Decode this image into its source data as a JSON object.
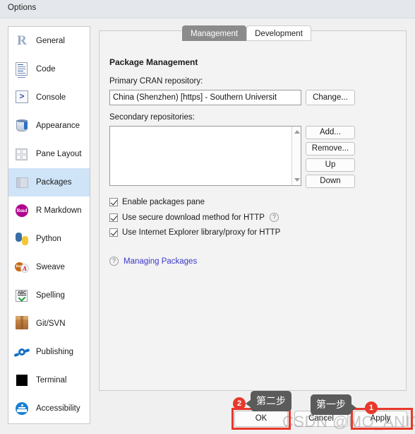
{
  "window": {
    "title": "Options"
  },
  "sidebar": {
    "items": [
      {
        "label": "General",
        "icon": "r-logo-icon"
      },
      {
        "label": "Code",
        "icon": "code-document-icon"
      },
      {
        "label": "Console",
        "icon": "console-prompt-icon"
      },
      {
        "label": "Appearance",
        "icon": "paint-bucket-icon"
      },
      {
        "label": "Pane Layout",
        "icon": "pane-grid-icon"
      },
      {
        "label": "Packages",
        "icon": "package-box-icon",
        "selected": true
      },
      {
        "label": "R Markdown",
        "icon": "rmd-badge-icon"
      },
      {
        "label": "Python",
        "icon": "python-logo-icon"
      },
      {
        "label": "Sweave",
        "icon": "sweave-pdf-icon"
      },
      {
        "label": "Spelling",
        "icon": "spellcheck-abc-icon"
      },
      {
        "label": "Git/SVN",
        "icon": "git-box-icon"
      },
      {
        "label": "Publishing",
        "icon": "publishing-orbit-icon"
      },
      {
        "label": "Terminal",
        "icon": "terminal-square-icon"
      },
      {
        "label": "Accessibility",
        "icon": "accessibility-person-icon"
      }
    ]
  },
  "main": {
    "tabs": [
      {
        "label": "Management",
        "active": true
      },
      {
        "label": "Development",
        "active": false
      }
    ],
    "section_title": "Package Management",
    "cran": {
      "label": "Primary CRAN repository:",
      "value": "China (Shenzhen) [https] - Southern Universit",
      "change_button": "Change..."
    },
    "secondary": {
      "label": "Secondary repositories:",
      "value": "",
      "buttons": [
        "Add...",
        "Remove...",
        "Up",
        "Down"
      ]
    },
    "checkboxes": [
      {
        "label": "Enable packages pane",
        "checked": true,
        "help": false
      },
      {
        "label": "Use secure download method for HTTP",
        "checked": true,
        "help": true
      },
      {
        "label": "Use Internet Explorer library/proxy for HTTP",
        "checked": true,
        "help": false
      }
    ],
    "help_link": {
      "icon": "question-mark-icon",
      "label": "Managing Packages"
    }
  },
  "footer": {
    "ok_label": "OK",
    "cancel_label": "Cancel",
    "apply_label": "Apply"
  },
  "annotations": {
    "step_two": {
      "badge": "2",
      "callout": "第二步"
    },
    "step_one": {
      "badge": "1",
      "callout": "第一步"
    },
    "highlight_color": "#e8382b"
  },
  "watermark": "CSDN @MO_ANICA"
}
